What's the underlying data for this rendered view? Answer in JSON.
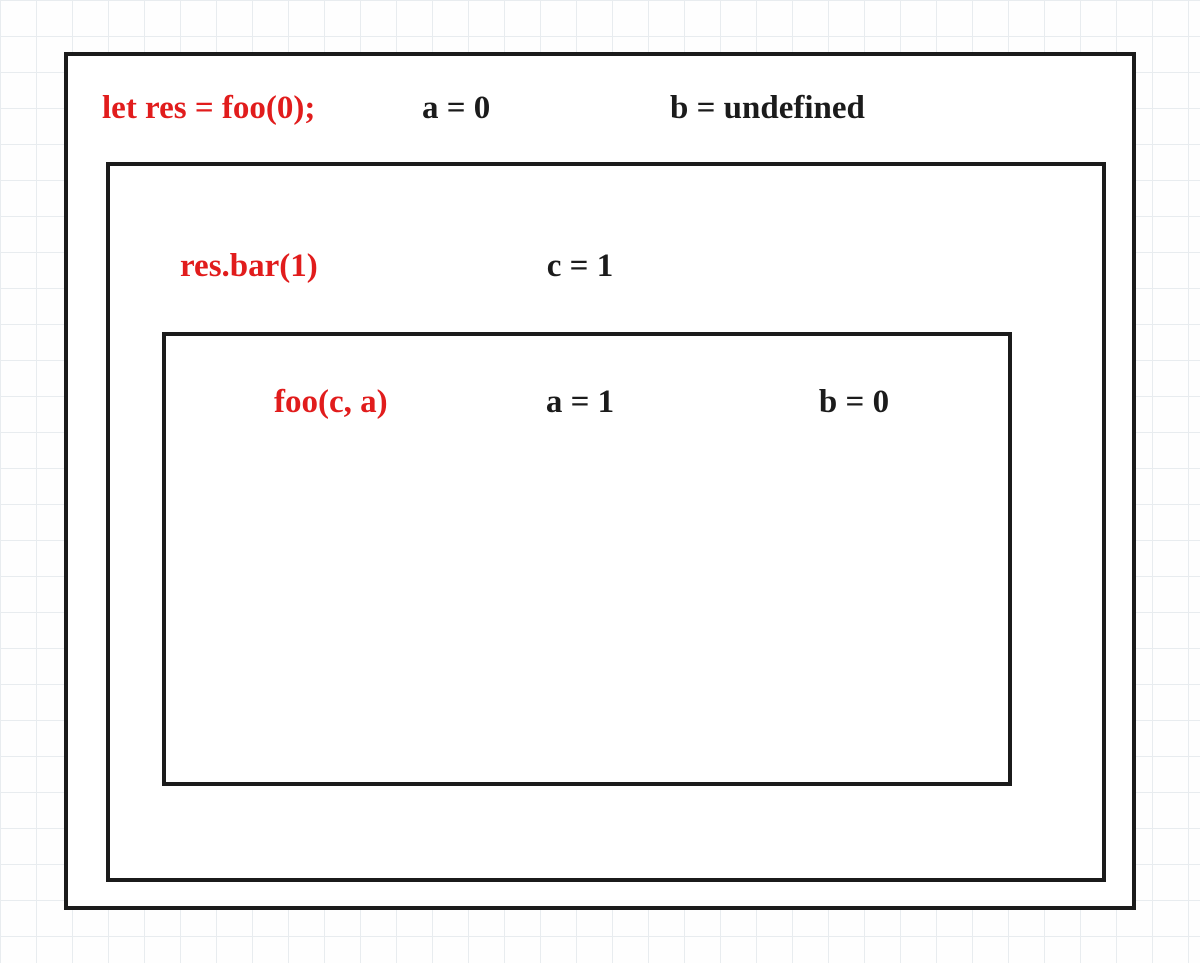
{
  "outer": {
    "call": "let res = foo(0);",
    "vars": {
      "a": "a = 0",
      "b": "b = undefined"
    }
  },
  "mid": {
    "call": "res.bar(1)",
    "vars": {
      "c": "c = 1"
    }
  },
  "inner": {
    "call": "foo(c, a)",
    "vars": {
      "a": "a = 1",
      "b": "b = 0"
    }
  }
}
